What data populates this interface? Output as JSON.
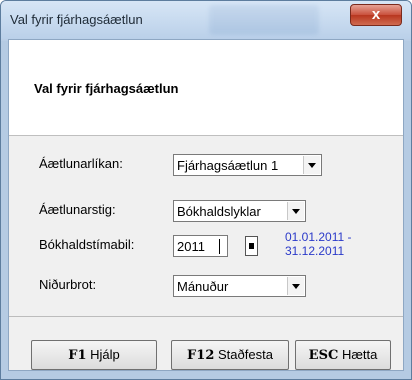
{
  "window": {
    "title": "Val fyrir fjárhagsáætlun",
    "close_glyph": "x"
  },
  "header": {
    "title": "Val fyrir fjárhagsáætlun"
  },
  "form": {
    "aaetlunarlikan": {
      "label": "Áætlunarlíkan:",
      "value": "Fjárhagsáætlun 1"
    },
    "aaetlunarstig": {
      "label": "Áætlunarstig:",
      "value": "Bókhaldslyklar"
    },
    "bokhaldstimabil": {
      "label": "Bókhaldstímabil:",
      "value": "2011",
      "date_range_line1": "01.01.2011 -",
      "date_range_line2": "31.12.2011"
    },
    "nidurbrot": {
      "label": "Niðurbrot:",
      "value": "Mánuður"
    }
  },
  "buttons": {
    "help": {
      "key": "F1",
      "label": "Hjálp"
    },
    "confirm": {
      "key": "F12",
      "label": "Staðfesta"
    },
    "cancel": {
      "key": "ESC",
      "label": "Hætta"
    }
  },
  "colors": {
    "date_text": "#2a39c9",
    "close_button": "#c9503c"
  }
}
